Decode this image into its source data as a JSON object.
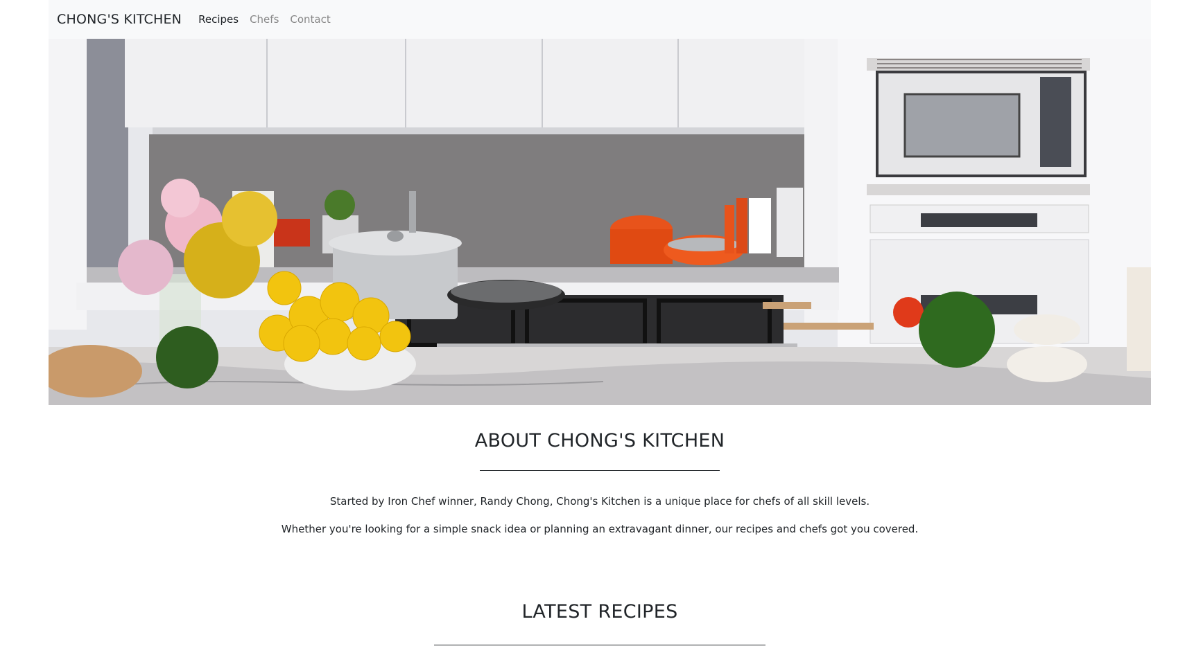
{
  "navbar": {
    "brand": "CHONG'S KITCHEN",
    "links": [
      {
        "label": "Recipes",
        "active": true
      },
      {
        "label": "Chefs",
        "active": false
      },
      {
        "label": "Contact",
        "active": false
      }
    ]
  },
  "hero": {
    "icon": "kitchen-hero-image"
  },
  "about": {
    "title": "ABOUT CHONG'S KITCHEN",
    "paragraphs": [
      "Started by Iron Chef winner, Randy Chong, Chong's Kitchen is a unique place for chefs of all skill levels.",
      "Whether you're looking for a simple snack idea or planning an extravagant dinner, our recipes and chefs got you covered."
    ]
  },
  "latest": {
    "title": "LATEST RECIPES"
  },
  "colors": {
    "navbar_bg": "#f8f9fa",
    "text": "#212529",
    "nav_muted": "#888888",
    "accent_orange": "#e8531b",
    "lemon": "#f2c40f"
  }
}
